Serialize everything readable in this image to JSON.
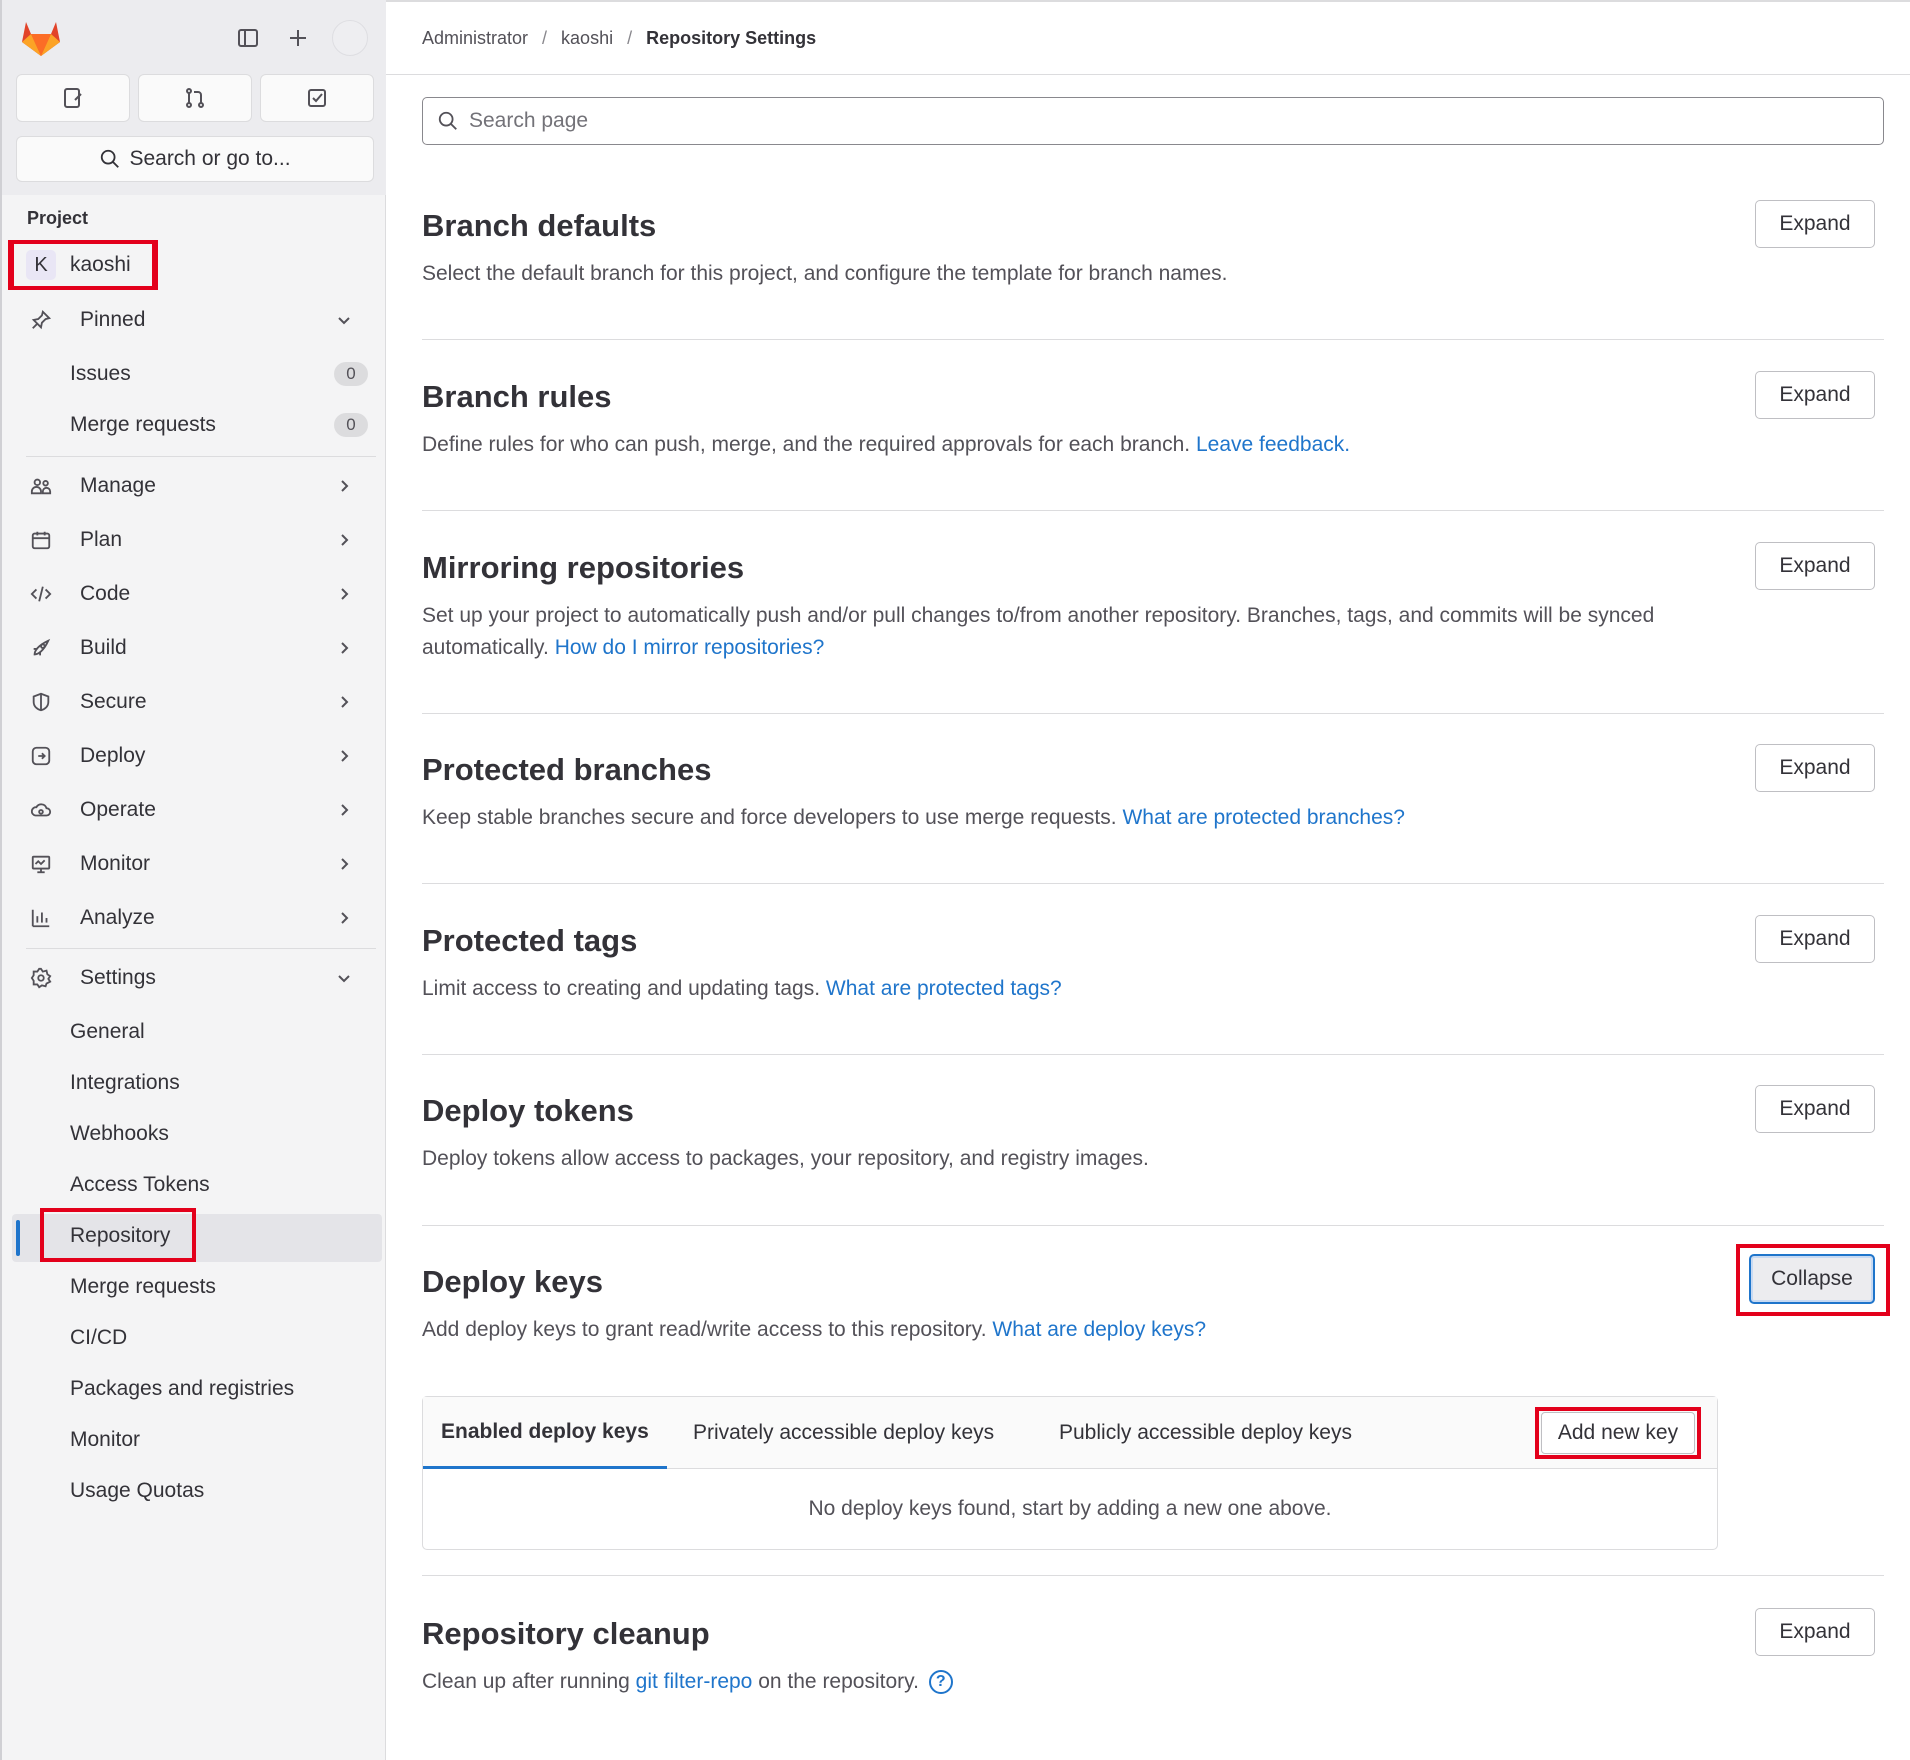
{
  "sidebar": {
    "search_label": "Search or go to...",
    "section_label": "Project",
    "project": {
      "initial": "K",
      "name": "kaoshi"
    },
    "pinned": {
      "label": "Pinned",
      "items": [
        {
          "label": "Issues",
          "count": "0"
        },
        {
          "label": "Merge requests",
          "count": "0"
        }
      ]
    },
    "groups": [
      {
        "label": "Manage",
        "icon": "users-icon"
      },
      {
        "label": "Plan",
        "icon": "calendar-icon"
      },
      {
        "label": "Code",
        "icon": "code-icon"
      },
      {
        "label": "Build",
        "icon": "rocket-icon"
      },
      {
        "label": "Secure",
        "icon": "shield-icon"
      },
      {
        "label": "Deploy",
        "icon": "deploy-icon"
      },
      {
        "label": "Operate",
        "icon": "cloud-gear-icon"
      },
      {
        "label": "Monitor",
        "icon": "monitor-icon"
      },
      {
        "label": "Analyze",
        "icon": "chart-icon"
      }
    ],
    "settings": {
      "label": "Settings",
      "items": [
        "General",
        "Integrations",
        "Webhooks",
        "Access Tokens",
        "Repository",
        "Merge requests",
        "CI/CD",
        "Packages and registries",
        "Monitor",
        "Usage Quotas"
      ],
      "active": "Repository"
    }
  },
  "breadcrumb": {
    "items": [
      "Administrator",
      "kaoshi",
      "Repository Settings"
    ],
    "separator": "/"
  },
  "search": {
    "placeholder": "Search page"
  },
  "sections": [
    {
      "title": "Branch defaults",
      "desc": "Select the default branch for this project, and configure the template for branch names.",
      "link": "",
      "button": "Expand"
    },
    {
      "title": "Branch rules",
      "desc": "Define rules for who can push, merge, and the required approvals for each branch.",
      "link": "Leave feedback.",
      "button": "Expand"
    },
    {
      "title": "Mirroring repositories",
      "desc": "Set up your project to automatically push and/or pull changes to/from another repository. Branches, tags, and commits will be synced automatically.",
      "link": "How do I mirror repositories?",
      "button": "Expand"
    },
    {
      "title": "Protected branches",
      "desc": "Keep stable branches secure and force developers to use merge requests.",
      "link": "What are protected branches?",
      "button": "Expand"
    },
    {
      "title": "Protected tags",
      "desc": "Limit access to creating and updating tags.",
      "link": "What are protected tags?",
      "button": "Expand"
    },
    {
      "title": "Deploy tokens",
      "desc": "Deploy tokens allow access to packages, your repository, and registry images.",
      "link": "",
      "button": "Expand"
    },
    {
      "title": "Deploy keys",
      "desc": "Add deploy keys to grant read/write access to this repository.",
      "link": "What are deploy keys?",
      "button": "Collapse"
    },
    {
      "title": "Repository cleanup",
      "desc_before": "Clean up after running",
      "link": "git filter-repo",
      "desc_after": "on the repository.",
      "button": "Expand"
    }
  ],
  "deploy_keys": {
    "tabs": [
      "Enabled deploy keys",
      "Privately accessible deploy keys",
      "Publicly accessible deploy keys"
    ],
    "active_tab": "Enabled deploy keys",
    "add_button": "Add new key",
    "empty_message": "No deploy keys found, start by adding a new one above."
  },
  "colors": {
    "link": "#1f75cb",
    "highlight": "#e3001b",
    "brand": "#fc6d26"
  }
}
